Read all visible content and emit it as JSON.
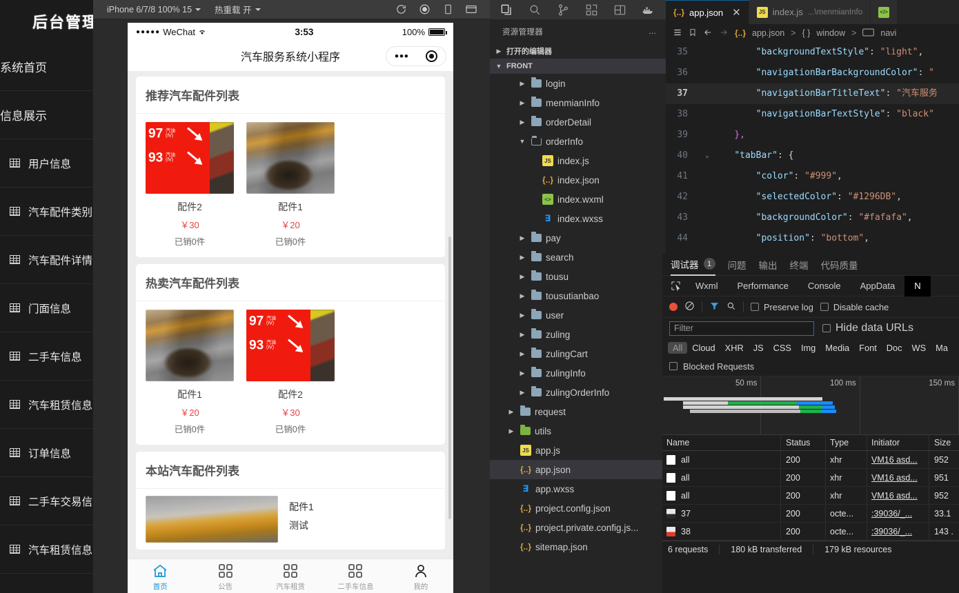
{
  "admin": {
    "title": "后台管理",
    "links": [
      "系统首页",
      "信息展示"
    ],
    "items": [
      "用户信息",
      "汽车配件类别",
      "汽车配件详情",
      "门面信息",
      "二手车信息",
      "汽车租赁信息",
      "订单信息",
      "二手车交易信",
      "汽车租赁信息"
    ]
  },
  "simulator": {
    "toolbar": {
      "device": "iPhone 6/7/8 100% 15",
      "hot_reload": "热重载 开",
      "icons": [
        "refresh-icon",
        "record-icon",
        "device-icon",
        "window-icon"
      ]
    },
    "status_bar": {
      "carrier_dots": "●●●●●",
      "carrier": "WeChat",
      "wifi": "wifi-icon",
      "time": "3:53",
      "battery_pct": "100%"
    },
    "nav_title": "汽车服务系统小程序",
    "sections": [
      {
        "heading": "推荐汽车配件列表",
        "layout": "grid",
        "goods": [
          {
            "image": "price-board-photo",
            "name": "配件2",
            "price": "￥30",
            "sold": "已销0件"
          },
          {
            "image": "oil-pour-photo",
            "name": "配件1",
            "price": "￥20",
            "sold": "已销0件"
          }
        ]
      },
      {
        "heading": "热卖汽车配件列表",
        "layout": "grid",
        "goods": [
          {
            "image": "oil-pour-photo",
            "name": "配件1",
            "price": "￥20",
            "sold": "已销0件"
          },
          {
            "image": "price-board-photo",
            "name": "配件2",
            "price": "￥30",
            "sold": "已销0件"
          }
        ]
      },
      {
        "heading": "本站汽车配件列表",
        "layout": "list",
        "rows": [
          {
            "image": "oil-bottle-photo",
            "title": "配件1",
            "sub": "测试"
          }
        ]
      }
    ],
    "tabbar": [
      {
        "icon": "home-icon",
        "label": "首页",
        "active": true
      },
      {
        "icon": "grid-icon",
        "label": "公告",
        "active": false
      },
      {
        "icon": "grid-icon",
        "label": "汽车租赁",
        "active": false
      },
      {
        "icon": "grid-icon",
        "label": "二手车信息",
        "active": false
      },
      {
        "icon": "person-icon",
        "label": "我的",
        "active": false
      }
    ]
  },
  "explorer": {
    "activity_icons": [
      "files-icon",
      "search-icon",
      "source-control-icon",
      "extensions-icon",
      "layout-icon",
      "docker-icon"
    ],
    "header": "资源管理器",
    "header_more": "...",
    "open_editors": "打开的编辑器",
    "workspace": "FRONT",
    "tree": [
      {
        "name": "login",
        "kind": "folder",
        "indent": 2,
        "state": "collapsed"
      },
      {
        "name": "menmianInfo",
        "kind": "folder",
        "indent": 2,
        "state": "collapsed"
      },
      {
        "name": "orderDetail",
        "kind": "folder",
        "indent": 2,
        "state": "collapsed"
      },
      {
        "name": "orderInfo",
        "kind": "folder-open",
        "indent": 2,
        "state": "expanded"
      },
      {
        "name": "index.js",
        "kind": "js",
        "indent": 3,
        "state": ""
      },
      {
        "name": "index.json",
        "kind": "json",
        "indent": 3,
        "state": ""
      },
      {
        "name": "index.wxml",
        "kind": "wxml",
        "indent": 3,
        "state": ""
      },
      {
        "name": "index.wxss",
        "kind": "wxss",
        "indent": 3,
        "state": ""
      },
      {
        "name": "pay",
        "kind": "folder",
        "indent": 2,
        "state": "collapsed"
      },
      {
        "name": "search",
        "kind": "folder",
        "indent": 2,
        "state": "collapsed"
      },
      {
        "name": "tousu",
        "kind": "folder",
        "indent": 2,
        "state": "collapsed"
      },
      {
        "name": "tousutianbao",
        "kind": "folder",
        "indent": 2,
        "state": "collapsed"
      },
      {
        "name": "user",
        "kind": "folder",
        "indent": 2,
        "state": "collapsed"
      },
      {
        "name": "zuling",
        "kind": "folder",
        "indent": 2,
        "state": "collapsed"
      },
      {
        "name": "zulingCart",
        "kind": "folder",
        "indent": 2,
        "state": "collapsed"
      },
      {
        "name": "zulingInfo",
        "kind": "folder",
        "indent": 2,
        "state": "collapsed"
      },
      {
        "name": "zulingOrderInfo",
        "kind": "folder",
        "indent": 2,
        "state": "collapsed"
      },
      {
        "name": "request",
        "kind": "folder",
        "indent": 1,
        "state": "collapsed"
      },
      {
        "name": "utils",
        "kind": "folder-green",
        "indent": 1,
        "state": "collapsed"
      },
      {
        "name": "app.js",
        "kind": "js",
        "indent": 1,
        "state": ""
      },
      {
        "name": "app.json",
        "kind": "json",
        "indent": 1,
        "state": "",
        "selected": true
      },
      {
        "name": "app.wxss",
        "kind": "wxss",
        "indent": 1,
        "state": ""
      },
      {
        "name": "project.config.json",
        "kind": "json",
        "indent": 1,
        "state": ""
      },
      {
        "name": "project.private.config.js...",
        "kind": "json",
        "indent": 1,
        "state": ""
      },
      {
        "name": "sitemap.json",
        "kind": "json",
        "indent": 1,
        "state": ""
      }
    ]
  },
  "editor": {
    "tabs": [
      {
        "icon": "json-icon",
        "label": "app.json",
        "detail": "",
        "active": true,
        "close": "✕"
      },
      {
        "icon": "js-icon",
        "label": "index.js",
        "detail": "...\\menmianInfo",
        "active": false,
        "close": ""
      },
      {
        "icon": "wxml-icon",
        "label": "",
        "detail": "",
        "active": false,
        "close": ""
      }
    ],
    "toolbar_icons": [
      "outline-icon",
      "bookmark-icon",
      "back-arrow-icon",
      "forward-arrow-icon"
    ],
    "breadcrumb": [
      "app.json",
      "window",
      "navi"
    ],
    "lines": [
      {
        "num": "35",
        "fold": "",
        "indent": 4,
        "key": "\"backgroundTextStyle\"",
        "sep": ": ",
        "value": "\"light\"",
        "tail": ",",
        "highlight": false
      },
      {
        "num": "36",
        "fold": "",
        "indent": 4,
        "key": "\"navigationBarBackgroundColor\"",
        "sep": ": ",
        "value": "\"",
        "tail": "",
        "highlight": false
      },
      {
        "num": "37",
        "fold": "",
        "indent": 4,
        "key": "\"navigationBarTitleText\"",
        "sep": ": ",
        "value": "\"汽车服务",
        "tail": "",
        "highlight": true
      },
      {
        "num": "38",
        "fold": "",
        "indent": 4,
        "key": "\"navigationBarTextStyle\"",
        "sep": ": ",
        "value": "\"black\"",
        "tail": "",
        "highlight": false
      },
      {
        "num": "39",
        "fold": "",
        "indent": 2,
        "key": "",
        "sep": "",
        "value": "",
        "tail": "},",
        "highlight": false,
        "brace": "},"
      },
      {
        "num": "40",
        "fold": "⌄",
        "indent": 2,
        "key": "\"tabBar\"",
        "sep": ": ",
        "value": "",
        "tail": "{",
        "highlight": false
      },
      {
        "num": "41",
        "fold": "",
        "indent": 4,
        "key": "\"color\"",
        "sep": ": ",
        "value": "\"#999\"",
        "tail": ",",
        "highlight": false
      },
      {
        "num": "42",
        "fold": "",
        "indent": 4,
        "key": "\"selectedColor\"",
        "sep": ": ",
        "value": "\"#1296DB\"",
        "tail": ",",
        "highlight": false
      },
      {
        "num": "43",
        "fold": "",
        "indent": 4,
        "key": "\"backgroundColor\"",
        "sep": ": ",
        "value": "\"#fafafa\"",
        "tail": ",",
        "highlight": false
      },
      {
        "num": "44",
        "fold": "",
        "indent": 4,
        "key": "\"position\"",
        "sep": ": ",
        "value": "\"bottom\"",
        "tail": ",",
        "highlight": false
      }
    ]
  },
  "debugger": {
    "panel_tabs": [
      {
        "label": "调试器",
        "badge": "1",
        "active": true
      },
      {
        "label": "问题",
        "badge": "",
        "active": false
      },
      {
        "label": "输出",
        "badge": "",
        "active": false
      },
      {
        "label": "终端",
        "badge": "",
        "active": false
      },
      {
        "label": "代码质量",
        "badge": "",
        "active": false
      }
    ],
    "devtool_tabs": [
      {
        "label": "Wxml",
        "active": false
      },
      {
        "label": "Performance",
        "active": false
      },
      {
        "label": "Console",
        "active": false
      },
      {
        "label": "AppData",
        "active": false
      },
      {
        "label": "N",
        "active": true
      }
    ],
    "network_controls": {
      "record": "record-icon",
      "clear": "clear-icon",
      "filter_toggle": "filter-icon",
      "search": "search-icon",
      "preserve_log": "Preserve log",
      "disable_cache": "Disable cache"
    },
    "filter_placeholder": "Filter",
    "hide_data_urls": "Hide data URLs",
    "resource_types": [
      "All",
      "Cloud",
      "XHR",
      "JS",
      "CSS",
      "Img",
      "Media",
      "Font",
      "Doc",
      "WS",
      "Ma"
    ],
    "blocked_requests": "Blocked Requests",
    "waterfall_ticks": [
      "50 ms",
      "100 ms",
      "150 ms"
    ],
    "table": {
      "columns": [
        "Name",
        "Status",
        "Type",
        "Initiator",
        "Size"
      ],
      "rows": [
        {
          "icon": "doc",
          "name": "all",
          "status": "200",
          "type": "xhr",
          "initiator": "VM16 asd...",
          "size": "952"
        },
        {
          "icon": "doc",
          "name": "all",
          "status": "200",
          "type": "xhr",
          "initiator": "VM16 asd...",
          "size": "951"
        },
        {
          "icon": "doc",
          "name": "all",
          "status": "200",
          "type": "xhr",
          "initiator": "VM16 asd...",
          "size": "952"
        },
        {
          "icon": "img",
          "name": "37",
          "status": "200",
          "type": "octe...",
          "initiator": ":39036/_...",
          "size": "33.1"
        },
        {
          "icon": "img2",
          "name": "38",
          "status": "200",
          "type": "octe...",
          "initiator": ":39036/_...",
          "size": "143 ."
        }
      ]
    },
    "footer": [
      "6 requests",
      "180 kB transferred",
      "179 kB resources"
    ]
  },
  "colors": {
    "accent_selected": "#1296DB",
    "tabbar_bg": "#fafafa",
    "tabbar_color": "#999",
    "price_red": "#e64340"
  }
}
